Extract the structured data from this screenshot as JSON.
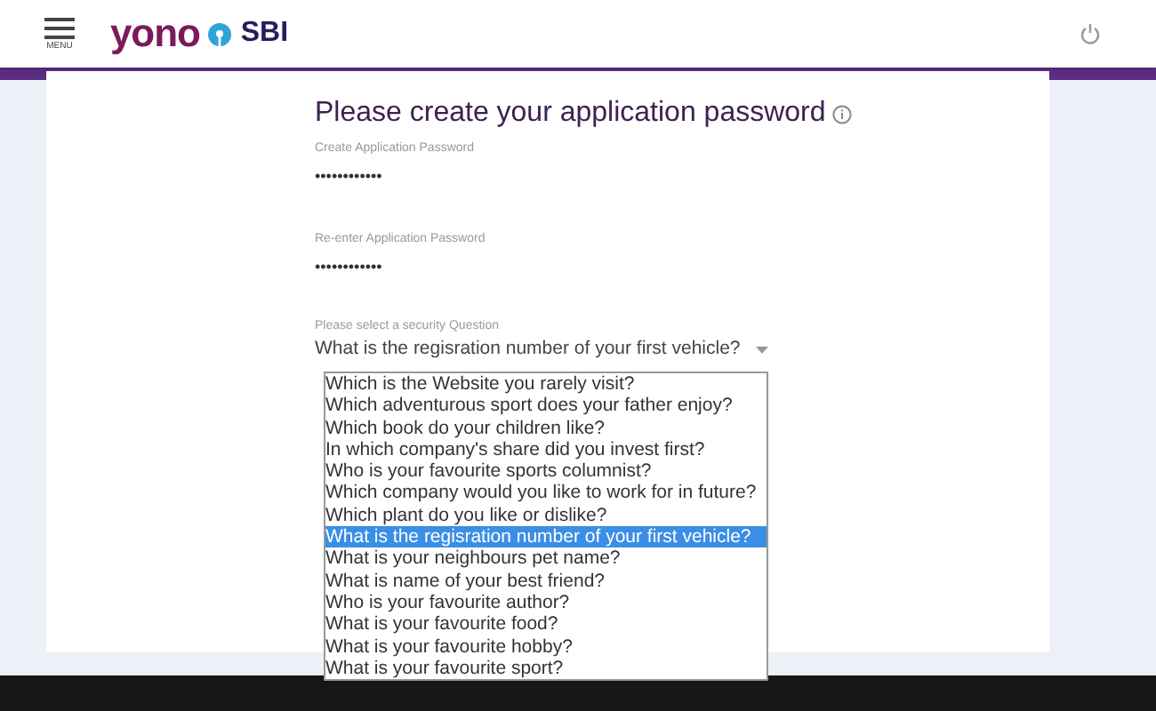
{
  "header": {
    "menu_label": "MENU",
    "logo_left": "yono",
    "logo_right": "SBI"
  },
  "form": {
    "title": "Please create your application password",
    "fields": [
      {
        "label": "Create Application Password",
        "value": "••••••••••••"
      },
      {
        "label": "Re-enter Application Password",
        "value": "••••••••••••"
      }
    ],
    "security_question": {
      "label": "Please select a security Question",
      "value": "What is the regisration number of your first vehicle?",
      "expanded": true,
      "options": [
        {
          "text": "Which is the Website you rarely visit?",
          "selected": false
        },
        {
          "text": "Which adventurous sport does your father enjoy?",
          "selected": false
        },
        {
          "text": "Which book do your children like?",
          "selected": false
        },
        {
          "text": "In which company's share did you invest first?",
          "selected": false
        },
        {
          "text": "Who is your favourite sports columnist?",
          "selected": false
        },
        {
          "text": "Which company would you like to work for in future?",
          "selected": false
        },
        {
          "text": "Which plant do you like or dislike?",
          "selected": false
        },
        {
          "text": "What is the regisration number of your first vehicle?",
          "selected": true
        },
        {
          "text": "What is your neighbours pet name?",
          "selected": false
        },
        {
          "text": "What is name of your best friend?",
          "selected": false
        },
        {
          "text": "Who is your favourite author?",
          "selected": false
        },
        {
          "text": "What is your favourite food?",
          "selected": false
        },
        {
          "text": "What is your favourite hobby?",
          "selected": false
        },
        {
          "text": "What is your favourite sport?",
          "selected": false
        }
      ]
    }
  }
}
